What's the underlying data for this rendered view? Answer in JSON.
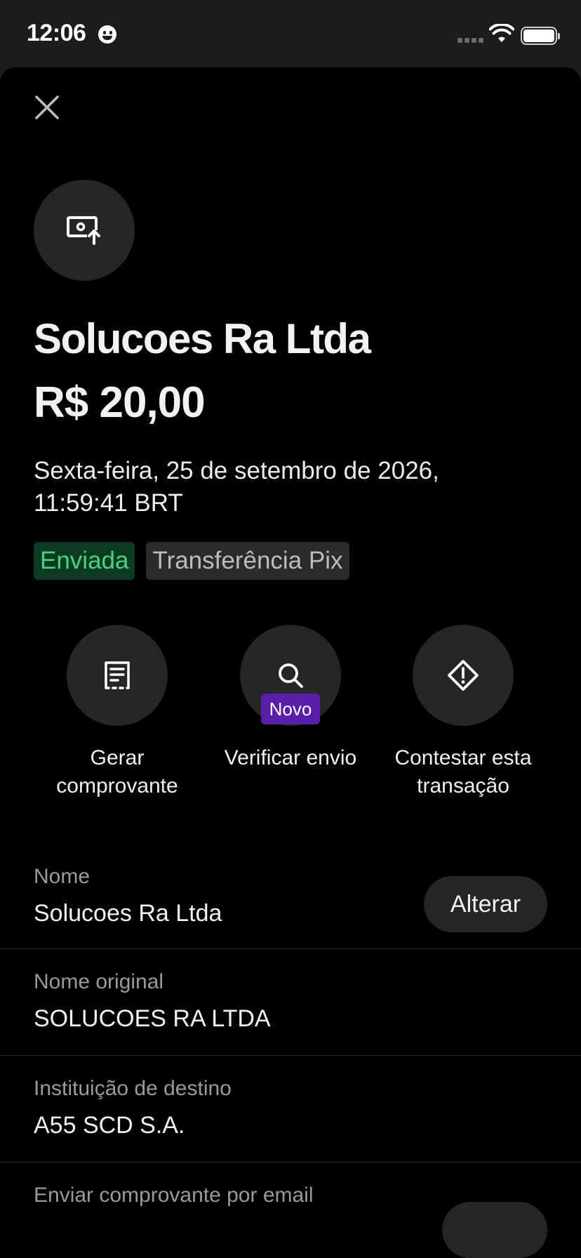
{
  "status_bar": {
    "time": "12:06"
  },
  "header": {
    "merchant_name": "Solucoes Ra Ltda",
    "amount": "R$ 20,00",
    "datetime": "Sexta-feira, 25 de setembro de 2026, 11:59:41 BRT"
  },
  "badges": {
    "status": "Enviada",
    "type": "Transferência Pix"
  },
  "actions": [
    {
      "label": "Gerar comprovante",
      "icon": "receipt-icon"
    },
    {
      "label": "Verificar envio",
      "icon": "search-icon",
      "badge": "Novo"
    },
    {
      "label": "Contestar esta transação",
      "icon": "alert-diamond-icon"
    }
  ],
  "details": {
    "name": {
      "label": "Nome",
      "value": "Solucoes Ra Ltda",
      "action": "Alterar"
    },
    "original_name": {
      "label": "Nome original",
      "value": "SOLUCOES RA LTDA"
    },
    "institution": {
      "label": "Instituição de destino",
      "value": "A55 SCD S.A."
    },
    "email_receipt": {
      "label": "Enviar comprovante por email"
    }
  },
  "colors": {
    "background": "#000000",
    "status_green": "#4cd080",
    "new_badge_purple": "#5b1ea6"
  }
}
